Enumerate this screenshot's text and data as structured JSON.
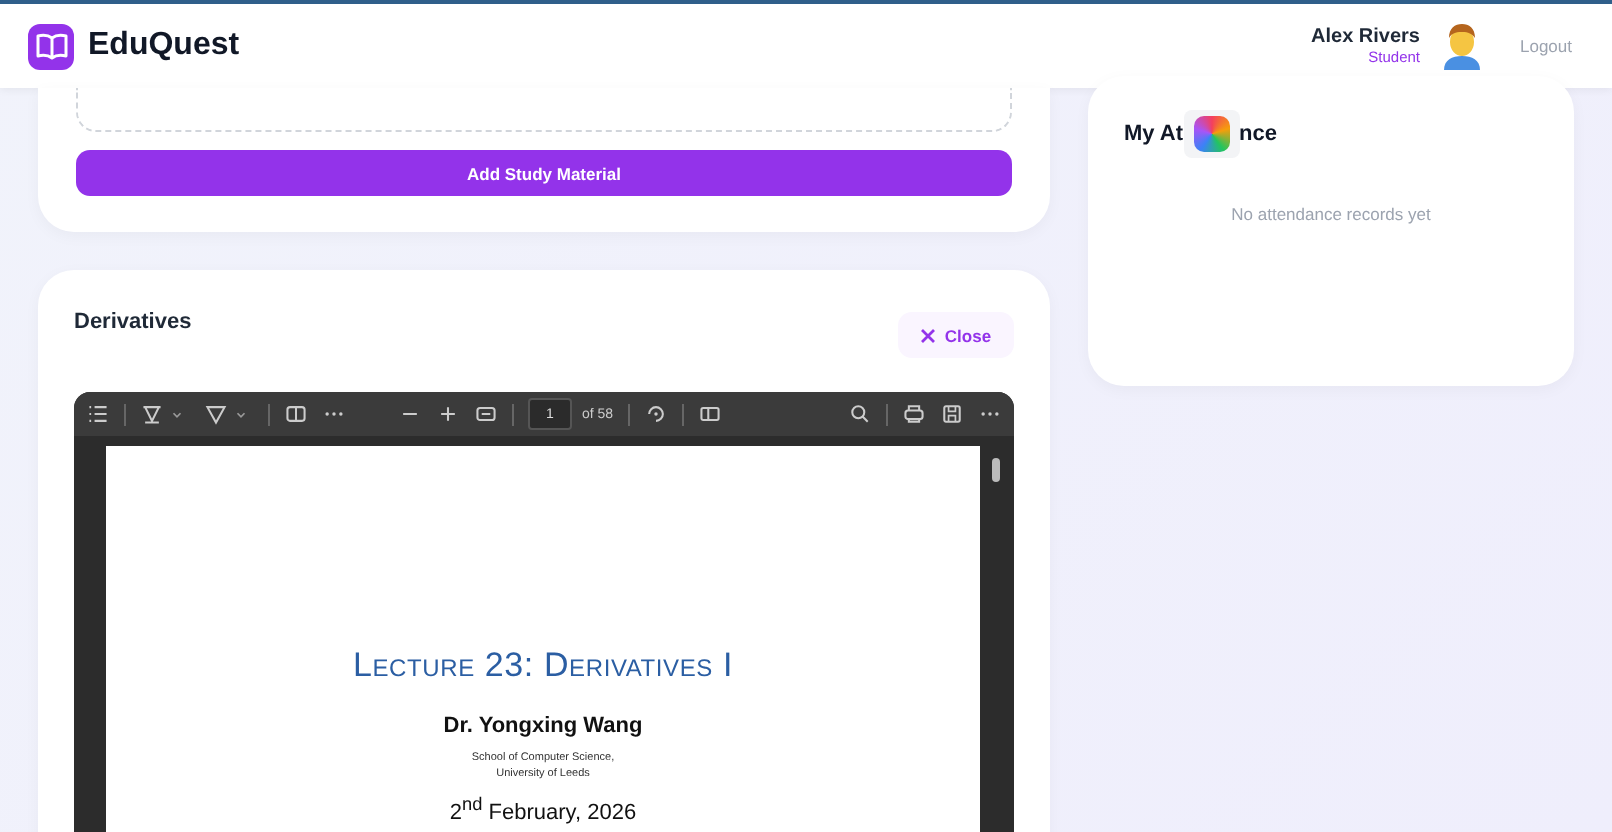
{
  "header": {
    "app_name": "EduQuest",
    "user": {
      "name": "Alex Rivers",
      "role": "Student"
    },
    "logout": "Logout"
  },
  "upload_card": {
    "button": "Add Study Material"
  },
  "viewer_card": {
    "title": "Derivatives",
    "close": "Close"
  },
  "pdf_viewer": {
    "page_input": "1",
    "page_count": "of 58",
    "document": {
      "title": "Lecture 23: Derivatives I",
      "author": "Dr. Yongxing Wang",
      "affiliation": [
        "School of Computer Science,",
        "University of Leeds"
      ],
      "date": "2$^{nd}$ February, 2026"
    }
  },
  "attendance": {
    "title_parts": [
      "My At",
      "nce"
    ],
    "empty_message": "No attendance records yet"
  }
}
